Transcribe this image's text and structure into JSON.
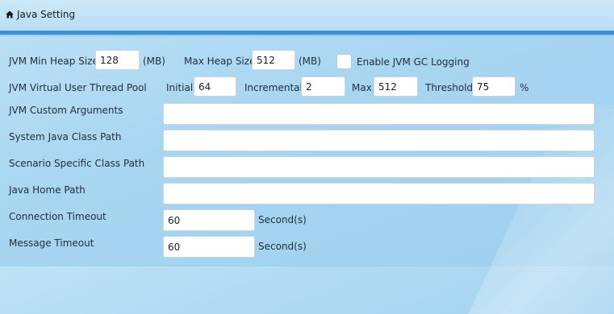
{
  "header": {
    "title": "Java Setting",
    "icon": "home-icon"
  },
  "jvm_heap": {
    "label": "JVM Min Heap Size",
    "min_value": "128",
    "min_unit": "(MB)",
    "max_label": "Max Heap Size",
    "max_value": "512",
    "max_unit": "(MB)",
    "gc_logging_label": "Enable JVM GC Logging",
    "gc_logging_checked": false
  },
  "thread_pool": {
    "label": "JVM Virtual User Thread Pool",
    "initial_label": "Initial",
    "initial_value": "64",
    "incremental_label": "Incremental",
    "incremental_value": "2",
    "max_label": "Max",
    "max_value": "512",
    "threshold_label": "Threshold",
    "threshold_value": "75",
    "threshold_unit": "%"
  },
  "custom_args": {
    "label": "JVM Custom Arguments",
    "value": ""
  },
  "system_class_path": {
    "label": "System Java Class Path",
    "value": ""
  },
  "scenario_class_path": {
    "label": "Scenario Specific Class Path",
    "value": ""
  },
  "java_home": {
    "label": "Java Home Path",
    "value": ""
  },
  "connection_timeout": {
    "label": "Connection Timeout",
    "value": "60",
    "unit": "Second(s)"
  },
  "message_timeout": {
    "label": "Message Timeout",
    "value": "60",
    "unit": "Second(s)"
  }
}
